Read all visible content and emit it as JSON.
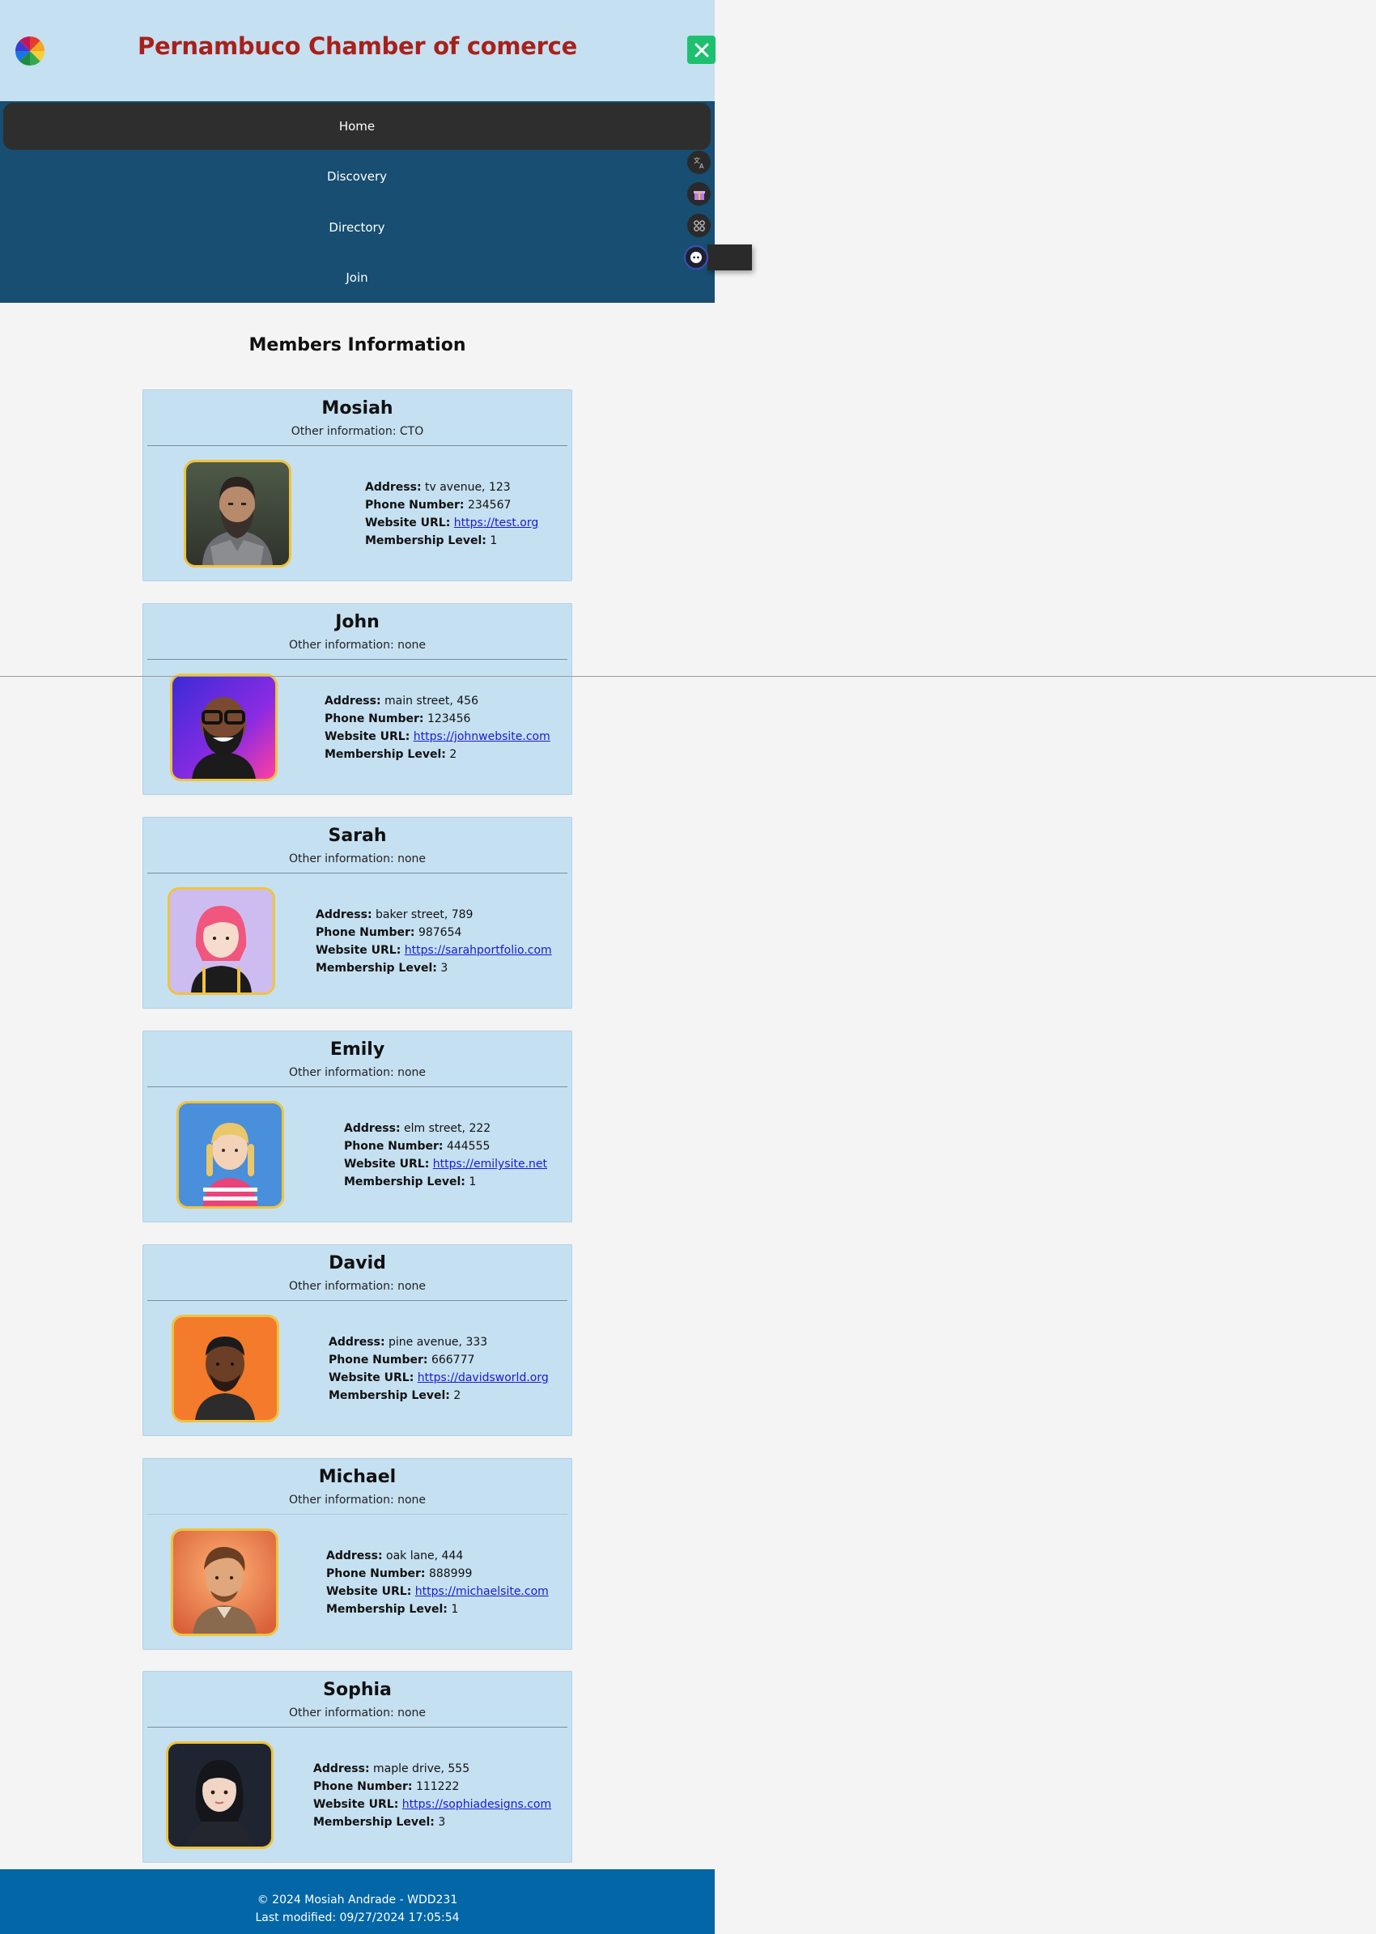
{
  "header": {
    "title": "Pernambuco Chamber of comerce",
    "logo_icon": "pinwheel-logo-icon",
    "close_icon": "close-icon"
  },
  "nav": {
    "items": [
      {
        "label": "Home",
        "active": true
      },
      {
        "label": "Discovery",
        "active": false
      },
      {
        "label": "Directory",
        "active": false
      },
      {
        "label": "Join",
        "active": false
      }
    ]
  },
  "floating_toolbar": {
    "icons": [
      "translate-icon",
      "gift-icon",
      "apps-icon",
      "chat-assistant-icon"
    ]
  },
  "main": {
    "title": "Members Information",
    "labels": {
      "other_prefix": "Other information: ",
      "address": "Address:",
      "phone": "Phone Number:",
      "website": "Website URL:",
      "membership": "Membership Level:"
    },
    "members": [
      {
        "name": "Mosiah",
        "other": "CTO",
        "address": "tv avenue, 123",
        "phone": "234567",
        "website": "https://test.org",
        "level": "1"
      },
      {
        "name": "John",
        "other": "none",
        "address": "main street, 456",
        "phone": "123456",
        "website": "https://johnwebsite.com",
        "level": "2"
      },
      {
        "name": "Sarah",
        "other": "none",
        "address": "baker street, 789",
        "phone": "987654",
        "website": "https://sarahportfolio.com",
        "level": "3"
      },
      {
        "name": "Emily",
        "other": "none",
        "address": "elm street, 222",
        "phone": "444555",
        "website": "https://emilysite.net",
        "level": "1"
      },
      {
        "name": "David",
        "other": "none",
        "address": "pine avenue, 333",
        "phone": "666777",
        "website": "https://davidsworld.org",
        "level": "2"
      },
      {
        "name": "Michael",
        "other": "none",
        "address": "oak lane, 444",
        "phone": "888999",
        "website": "https://michaelsite.com",
        "level": "1"
      },
      {
        "name": "Sophia",
        "other": "none",
        "address": "maple drive, 555",
        "phone": "111222",
        "website": "https://sophiadesigns.com",
        "level": "3"
      }
    ]
  },
  "footer": {
    "copyright": "© 2024 Mosiah Andrade - WDD231",
    "last_modified": "Last modified: 09/27/2024 17:05:54"
  },
  "colors": {
    "header_bg": "#c5e0f1",
    "title": "#a8201a",
    "nav_bg": "#174e72",
    "nav_active": "#2e2e2e",
    "card_bg": "#c5e0f1",
    "avatar_border": "#f0c33c",
    "close_btn": "#1ec06f",
    "footer_bg": "#0366a7",
    "link": "#1a1ad1"
  }
}
